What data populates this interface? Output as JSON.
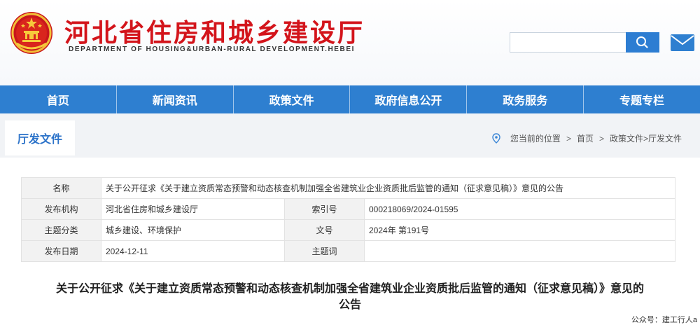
{
  "header": {
    "title": "河北省住房和城乡建设厅",
    "subtitle": "DEPARTMENT OF HOUSING&URBAN-RURAL DEVELOPMENT.HEBEI",
    "emblem_icon": "national-emblem-icon",
    "search": {
      "value": "",
      "placeholder": ""
    },
    "search_icon": "search-icon",
    "mail_icon": "mail-icon"
  },
  "nav": {
    "items": [
      {
        "label": "首页"
      },
      {
        "label": "新闻资讯"
      },
      {
        "label": "政策文件"
      },
      {
        "label": "政府信息公开"
      },
      {
        "label": "政务服务"
      },
      {
        "label": "专题专栏"
      }
    ]
  },
  "section": {
    "tab_label": "厅发文件",
    "breadcrumb": {
      "prefix": "您当前的位置",
      "items": [
        "首页",
        "政策文件>厅发文件"
      ]
    }
  },
  "meta": {
    "name_label": "名称",
    "name_value": "关于公开征求《关于建立资质常态预警和动态核查机制加强全省建筑业企业资质批后监管的通知（征求意见稿）》意见的公告",
    "publisher_label": "发布机构",
    "publisher_value": "河北省住房和城乡建设厅",
    "index_label": "索引号",
    "index_value": "000218069/2024-01595",
    "category_label": "主题分类",
    "category_value": "城乡建设、环境保护",
    "docno_label": "文号",
    "docno_value": "2024年 第191号",
    "date_label": "发布日期",
    "date_value": "2024-12-11",
    "keywords_label": "主题词",
    "keywords_value": ""
  },
  "article": {
    "title_line1": "关于公开征求《关于建立资质常态预警和动态核查机制加强全省建筑业企业资质批后监管的通知（征求意见稿）》意见的",
    "title_line2": "公告"
  },
  "watermark": "公众号：建工行人a",
  "colors": {
    "brand_red": "#d3141b",
    "nav_blue": "#2e7fd0",
    "accent_blue": "#2c73c9"
  }
}
